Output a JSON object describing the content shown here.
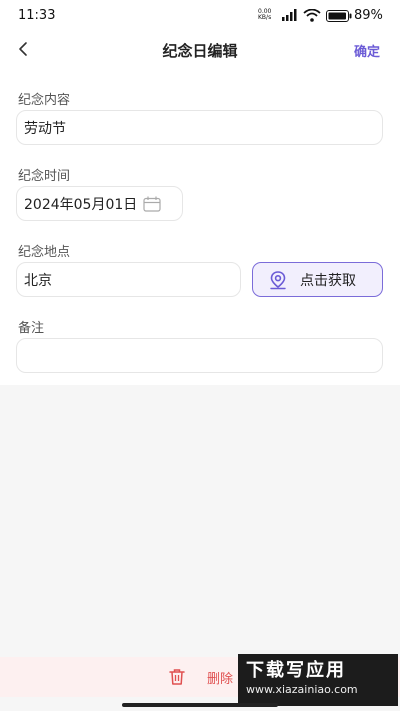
{
  "status_bar": {
    "time": "11:33",
    "net_speed_value": "0.00",
    "net_speed_unit": "KB/s",
    "battery": "89%"
  },
  "header": {
    "title": "纪念日编辑",
    "confirm_label": "确定"
  },
  "form": {
    "content_label": "纪念内容",
    "content_value": "劳动节",
    "time_label": "纪念时间",
    "time_value": "2024年05月01日",
    "location_label": "纪念地点",
    "location_value": "北京",
    "locate_button_label": "点击获取",
    "note_label": "备注",
    "note_value": ""
  },
  "footer": {
    "delete_label": "删除"
  },
  "watermark": {
    "line1": "下载写应用",
    "line2": "www.xiazainiao.com"
  },
  "colors": {
    "accent": "#6b5bd6",
    "danger": "#e05050"
  }
}
